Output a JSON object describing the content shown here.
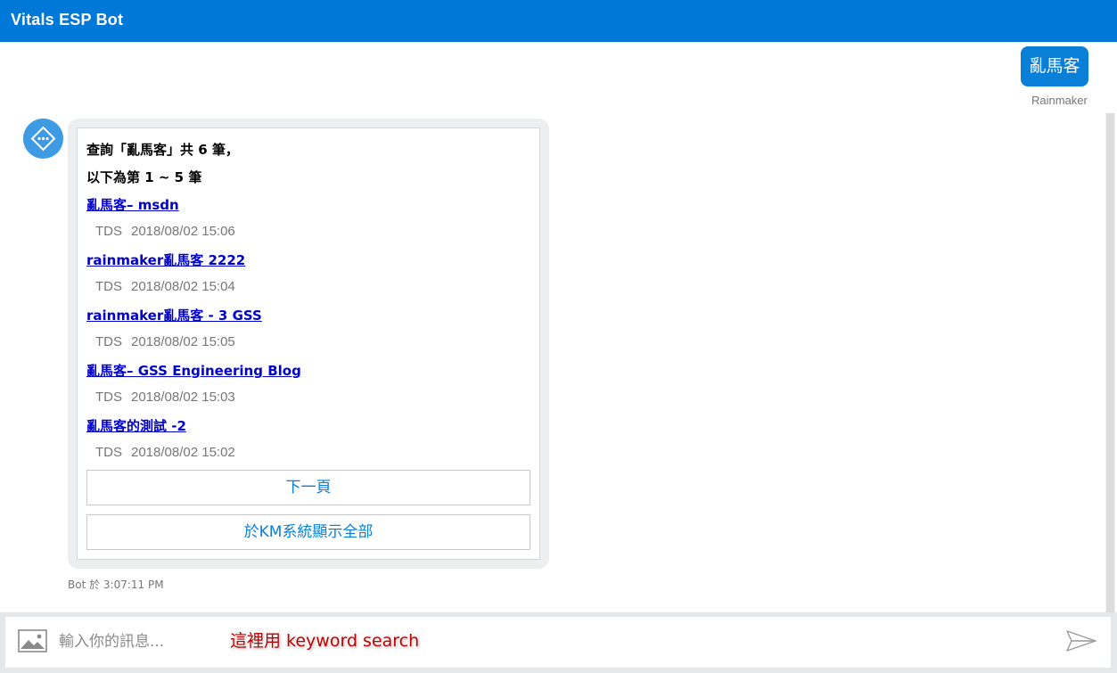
{
  "window": {
    "title": "Vitals ESP Bot"
  },
  "user_message": {
    "text": "亂馬客",
    "sender": "Rainmaker"
  },
  "bot_message": {
    "avatar_icon": "bot-code-icon",
    "header_line1": "查詢「亂馬客」共 6 筆，",
    "header_line2": "以下為第 1 ~ 5 筆",
    "results": [
      {
        "title": "亂馬客– msdn",
        "source": "TDS",
        "date": "2018/08/02 15:06"
      },
      {
        "title": "rainmaker亂馬客 2222",
        "source": "TDS",
        "date": "2018/08/02 15:04"
      },
      {
        "title": "rainmaker亂馬客 - 3 GSS",
        "source": "TDS",
        "date": "2018/08/02 15:05"
      },
      {
        "title": "亂馬客– GSS Engineering Blog",
        "source": "TDS",
        "date": "2018/08/02 15:03"
      },
      {
        "title": "亂馬客的測試 -2",
        "source": "TDS",
        "date": "2018/08/02 15:02"
      }
    ],
    "buttons": {
      "next_page": "下一頁",
      "show_all": "於KM系統顯示全部"
    },
    "timestamp": "Bot 於 3:07:11 PM"
  },
  "input": {
    "placeholder": "輸入你的訊息...",
    "annotation": "這裡用 keyword search",
    "image_icon": "image-upload-icon",
    "send_icon": "send-icon"
  },
  "colors": {
    "titlebar": "#0078d7",
    "user_bubble": "#0a7fd7",
    "link": "#0000cc",
    "annotation": "#c00000"
  }
}
